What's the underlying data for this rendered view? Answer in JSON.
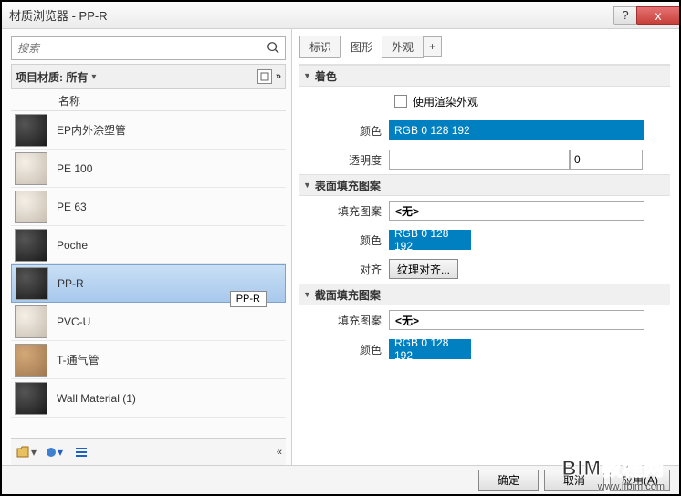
{
  "window": {
    "title": "材质浏览器 - PP-R",
    "help_icon": "?",
    "close_icon": "x"
  },
  "search": {
    "placeholder": "搜索"
  },
  "project_filter": {
    "label": "项目材质: 所有",
    "arrow": "▾",
    "expand": "»"
  },
  "list": {
    "name_header": "名称",
    "items": [
      {
        "label": "EP内外涂塑管",
        "style": "dark"
      },
      {
        "label": "PE 100",
        "style": "light"
      },
      {
        "label": "PE 63",
        "style": "light"
      },
      {
        "label": "Poche",
        "style": "dark"
      },
      {
        "label": "PP-R",
        "style": "dark",
        "selected": true
      },
      {
        "label": "PVC-U",
        "style": "light"
      },
      {
        "label": "T-通气管",
        "style": "tan"
      },
      {
        "label": "Wall Material (1)",
        "style": "dark"
      }
    ],
    "tooltip": "PP-R"
  },
  "bottom_toolbar": {
    "collapse": "«"
  },
  "tabs": {
    "identity": "标识",
    "graphics": "图形",
    "appearance": "外观",
    "add": "+"
  },
  "sections": {
    "shading": {
      "title": "着色",
      "use_render": "使用渲染外观",
      "color_label": "颜色",
      "color_value": "RGB 0 128 192",
      "trans_label": "透明度",
      "trans_value": "0"
    },
    "surface": {
      "title": "表面填充图案",
      "pattern_label": "填充图案",
      "pattern_value": "<无>",
      "color_label": "颜色",
      "color_value": "RGB 0 128 192",
      "align_label": "对齐",
      "align_btn": "纹理对齐..."
    },
    "cut": {
      "title": "截面填充图案",
      "pattern_label": "填充图案",
      "pattern_value": "<无>",
      "color_label": "颜色",
      "color_value": "RGB 0 128 192"
    }
  },
  "footer": {
    "ok": "确定",
    "cancel": "取消",
    "apply": "应用(A)"
  },
  "watermark": {
    "big": "BIM教程网",
    "small": "www.ifbim.com"
  },
  "chart_data": null
}
